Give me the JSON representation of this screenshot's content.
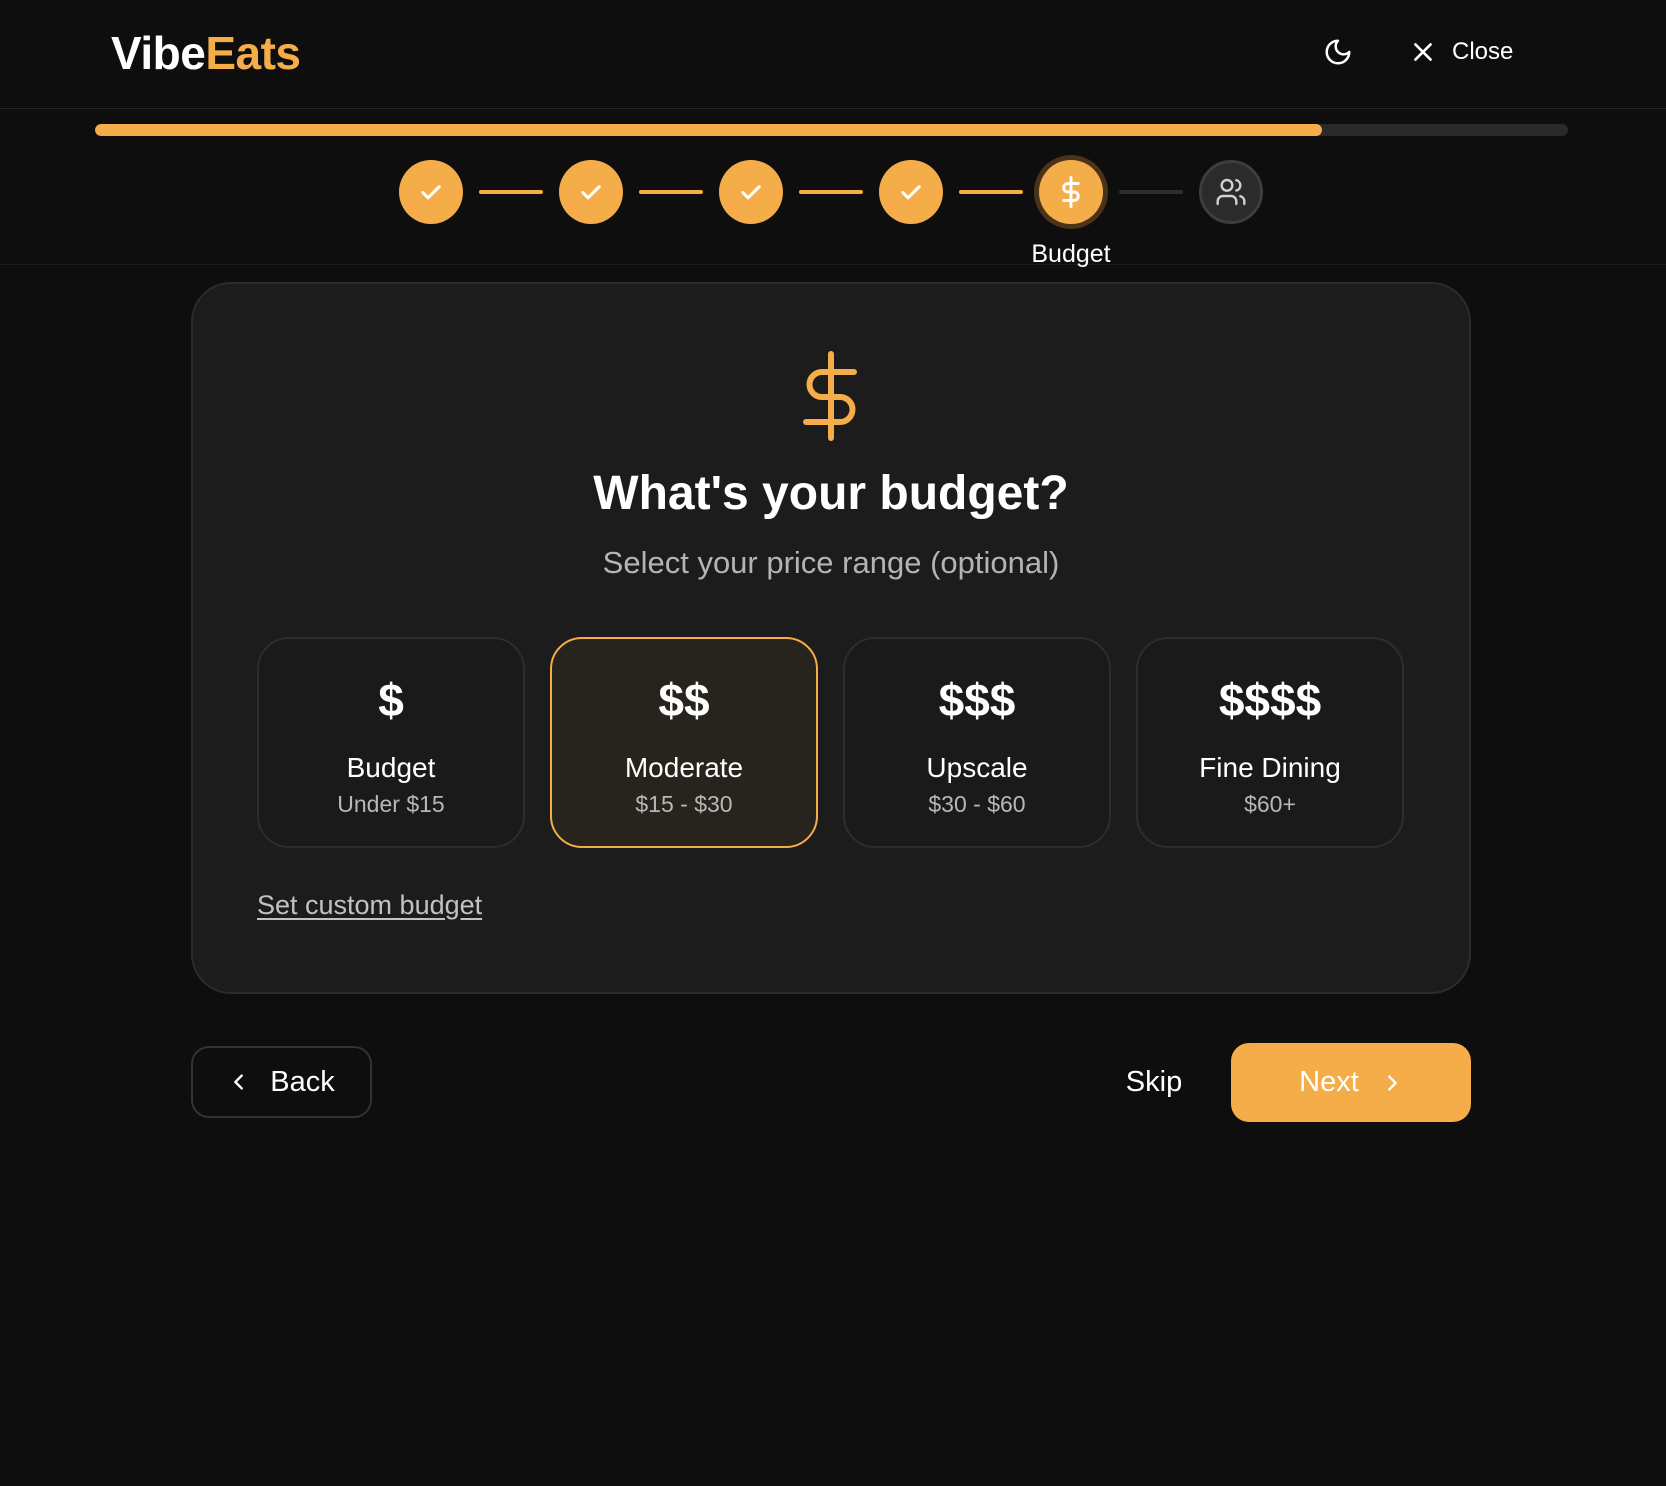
{
  "app": {
    "logo_part1": "Vibe",
    "logo_part2": "Eats"
  },
  "header": {
    "theme_icon": "moon-icon",
    "close_label": "Close"
  },
  "progress": {
    "percent": 83.3,
    "steps": [
      {
        "state": "done",
        "icon": "check-icon"
      },
      {
        "state": "done",
        "icon": "check-icon"
      },
      {
        "state": "done",
        "icon": "check-icon"
      },
      {
        "state": "done",
        "icon": "check-icon"
      },
      {
        "state": "current",
        "icon": "dollar-icon"
      },
      {
        "state": "upcoming",
        "icon": "users-icon"
      }
    ],
    "current_label": "Budget"
  },
  "question": {
    "icon": "dollar-icon",
    "title": "What's your budget?",
    "subtitle": "Select your price range (optional)"
  },
  "options": [
    {
      "symbol": "$",
      "name": "Budget",
      "range": "Under $15",
      "selected": false
    },
    {
      "symbol": "$$",
      "name": "Moderate",
      "range": "$15 - $30",
      "selected": true
    },
    {
      "symbol": "$$$",
      "name": "Upscale",
      "range": "$30 - $60",
      "selected": false
    },
    {
      "symbol": "$$$$",
      "name": "Fine Dining",
      "range": "$60+",
      "selected": false
    }
  ],
  "custom_link": "Set custom budget",
  "footer": {
    "back_label": "Back",
    "skip_label": "Skip",
    "next_label": "Next"
  },
  "colors": {
    "accent": "#f4ad48",
    "background": "#0e0e0e",
    "card": "#1c1c1c"
  }
}
